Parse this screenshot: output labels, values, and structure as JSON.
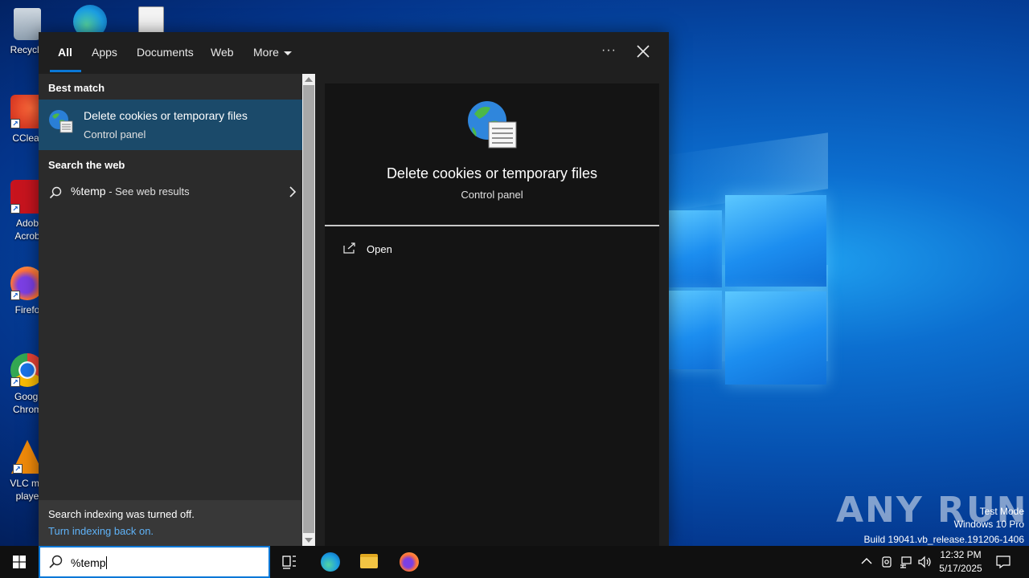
{
  "desktop": {
    "icons": [
      {
        "label": "Recycle",
        "icon": "recycle-bin-icon"
      },
      {
        "label": "CClear",
        "icon": "ccleaner-icon"
      },
      {
        "label": "Adob Acrob",
        "icon": "acrobat-icon"
      },
      {
        "label": "Firefo",
        "icon": "firefox-icon"
      },
      {
        "label": "Googl Chrom",
        "icon": "chrome-icon"
      },
      {
        "label": "VLC me playe",
        "icon": "vlc-icon"
      }
    ],
    "watermark": {
      "logo": "ANY RUN",
      "line1": "Test Mode",
      "line2": "Windows 10 Pro",
      "line3": "Build 19041.vb_release.191206-1406"
    }
  },
  "search": {
    "tabs": [
      {
        "label": "All",
        "active": true
      },
      {
        "label": "Apps"
      },
      {
        "label": "Documents"
      },
      {
        "label": "Web"
      },
      {
        "label": "More"
      }
    ],
    "more_options": "···",
    "best_match_heading": "Best match",
    "best_match": {
      "title": "Delete cookies or temporary files",
      "subtitle": "Control panel",
      "icon": "control-panel-globe-icon"
    },
    "web_heading": "Search the web",
    "web_result": {
      "query": "%temp",
      "hint": " - See web results"
    },
    "footer": {
      "message": "Search indexing was turned off.",
      "link": "Turn indexing back on."
    },
    "preview": {
      "title": "Delete cookies or temporary files",
      "subtitle": "Control panel",
      "actions": [
        {
          "label": "Open",
          "icon": "open-window-icon"
        }
      ]
    }
  },
  "taskbar": {
    "search_value": "%temp",
    "apps": [
      "task-view-icon",
      "edge-icon",
      "file-explorer-icon",
      "firefox-icon"
    ],
    "clock": {
      "time": "12:32 PM",
      "date": "5/17/2025"
    },
    "accent": "#0a78d7"
  }
}
